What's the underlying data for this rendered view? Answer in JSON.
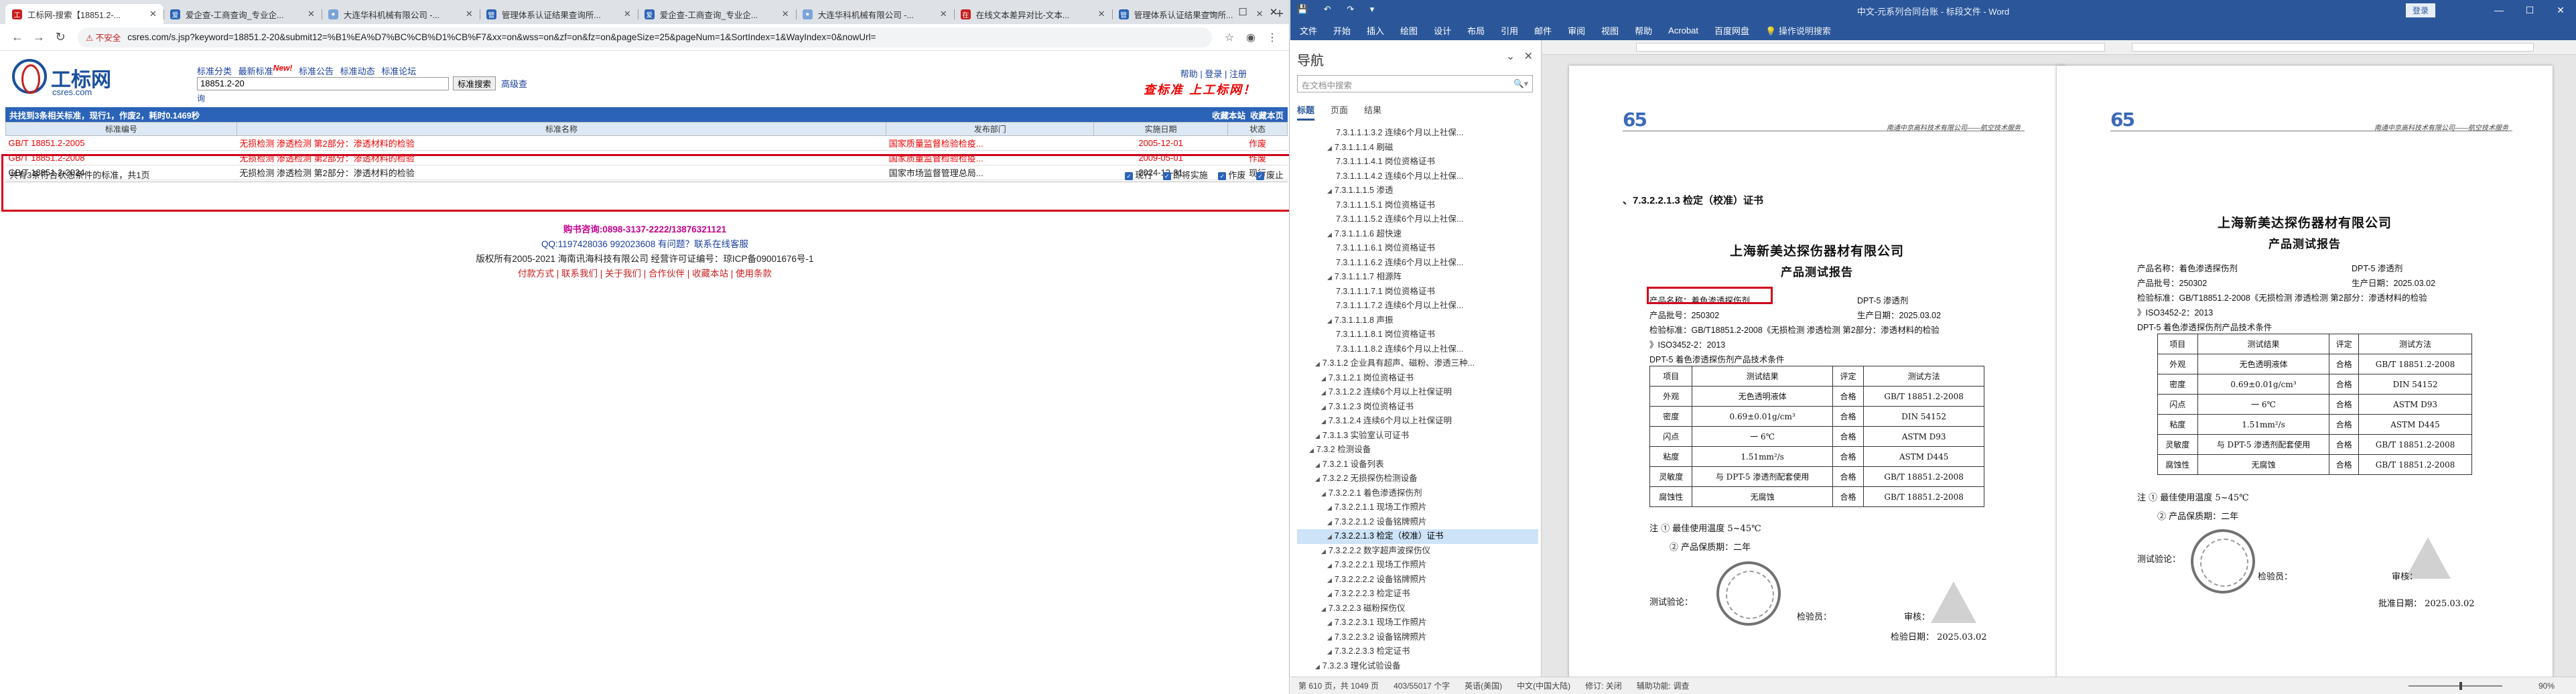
{
  "browser": {
    "tabs": [
      {
        "title": "工标网-搜索【18851.2-...",
        "active": true,
        "color": "#c81e1e"
      },
      {
        "title": "爱企查-工商查询_专业企...",
        "active": false,
        "color": "#2a63b8"
      },
      {
        "title": "大连华科机械有限公司 -...",
        "active": false,
        "color": "#2a63b8"
      },
      {
        "title": "管理体系认证结果查询所...",
        "active": false,
        "color": "#2a63b8"
      },
      {
        "title": "爱企查-工商查询_专业企...",
        "active": false,
        "color": "#2a63b8"
      },
      {
        "title": "大连华科机械有限公司 -...",
        "active": false,
        "color": "#2a63b8"
      },
      {
        "title": "在线文本差异对比-文本...",
        "active": false,
        "color": "#c81e1e"
      },
      {
        "title": "管理体系认证结果查询所...",
        "active": false,
        "color": "#2a63b8"
      }
    ],
    "new_tab": "+",
    "insecure_label": "不安全",
    "url": "csres.com/s.jsp?keyword=18851.2-20&submit12=%B1%EA%D7%BC%CB%D1%CB%F7&xx=on&wss=on&zf=on&fz=on&pageSize=25&pageNum=1&SortIndex=1&WayIndex=0&nowUrl="
  },
  "site": {
    "logo_cn": "工标网",
    "logo_en": "csres.com",
    "menu": [
      "标准分类",
      "最新标准",
      "New!",
      "标准公告",
      "标准动态",
      "标准论坛"
    ],
    "search_value": "18851.2-20",
    "search_button": "标准搜索",
    "advanced": "高级查",
    "tiny": "询",
    "login": "帮助 | 登录 | 注册",
    "slogan": "查标准 上工标网！",
    "result_bar_left": "共找到3条相关标准，现行1，作废2，耗时0.1469秒",
    "result_bar_right_1": "收藏本站",
    "result_bar_right_2": "收藏本页",
    "columns": [
      "标准编号",
      "标准名称",
      "发布部门",
      "实施日期",
      "状态"
    ],
    "rows": [
      {
        "std": "GB/T 18851.2-2005",
        "title": "无损检测 渗透检测 第2部分：渗透材料的检验",
        "dept": "国家质量监督检验检疫...",
        "date": "2005-12-01",
        "status": "作废",
        "obsolete": true
      },
      {
        "std": "GB/T 18851.2-2008",
        "title": "无损检测 渗透检测 第2部分：渗透材料的检验",
        "dept": "国家质量监督检验检疫...",
        "date": "2009-05-01",
        "status": "作废",
        "obsolete": true
      },
      {
        "std": "GB/T 18851.2-2024",
        "title": "无损检测 渗透检测 第2部分：渗透材料的检验",
        "dept": "国家市场监督管理总局...",
        "date": "2024-12-31",
        "status": "现行",
        "obsolete": false
      }
    ],
    "summary": "共有3条符合状态条件的标准，共1页",
    "filters": [
      "现行",
      "即将实施",
      "作废",
      "废止"
    ],
    "foot_phone": "购书咨询:0898-3137-2222/13876321121",
    "foot_qq": "QQ:1197428036 992023608 有问题？联系在线客服",
    "foot_copy": "版权所有2005-2021 海南讯海科技有限公司 经营许可证编号：琼ICP备09001676号-1",
    "foot_links": "付款方式 | 联系我们 | 关于我们 | 合作伙伴 | 收藏本站 | 使用条款"
  },
  "word": {
    "quick_access": "💾 ↶ ↷ ▾",
    "doc_title": "中文-元系列合同台账 - 标段文件 - Word",
    "user": "登录",
    "ribbon": [
      "文件",
      "开始",
      "插入",
      "绘图",
      "设计",
      "布局",
      "引用",
      "邮件",
      "审阅",
      "视图",
      "帮助",
      "Acrobat",
      "百度网盘",
      "操作说明搜索"
    ],
    "nav_title": "导航",
    "nav_search": "在文档中搜索",
    "nav_tabs": [
      "标题",
      "页面",
      "结果"
    ],
    "nav_items": [
      "7.3.1.1.1.3.2 连续6个月以上社保...",
      "7.3.1.1.1.4 刷磁",
      "7.3.1.1.1.4.1 岗位资格证书",
      "7.3.1.1.1.4.2 连续6个月以上社保...",
      "7.3.1.1.1.5 渗透",
      "7.3.1.1.1.5.1 岗位资格证书",
      "7.3.1.1.1.5.2 连续6个月以上社保...",
      "7.3.1.1.1.6 超快速",
      "7.3.1.1.1.6.1 岗位资格证书",
      "7.3.1.1.1.6.2 连续6个月以上社保...",
      "7.3.1.1.1.7 相源阵",
      "7.3.1.1.1.7.1 岗位资格证书",
      "7.3.1.1.1.7.2 连续6个月以上社保...",
      "7.3.1.1.1.8 声振",
      "7.3.1.1.1.8.1 岗位资格证书",
      "7.3.1.1.1.8.2 连续6个月以上社保...",
      "7.3.1.2 企业具有超声、磁粉、渗透三种...",
      "7.3.1.2.1 岗位资格证书",
      "7.3.1.2.2 连续6个月以上社保证明",
      "7.3.1.2.3 岗位资格证书",
      "7.3.1.2.4 连续6个月以上社保证明",
      "7.3.1.3 实验室认可证书",
      "7.3.2 检测设备",
      "7.3.2.1 设备列表",
      "7.3.2.2 无损探伤检测设备",
      "7.3.2.2.1 着色渗透探伤剂",
      "7.3.2.2.1.1 现场工作照片",
      "7.3.2.2.1.2 设备铭牌照片",
      "7.3.2.2.1.3 检定（校准）证书",
      "7.3.2.2.2 数字超声波探伤仪",
      "7.3.2.2.2.1 现场工作照片",
      "7.3.2.2.2.2 设备铭牌照片",
      "7.3.2.2.2.3 检定证书",
      "7.3.2.2.3 磁粉探伤仪",
      "7.3.2.2.3.1 现场工作照片",
      "7.3.2.2.3.2 设备铭牌照片",
      "7.3.2.2.3.3 检定证书",
      "7.3.2.3 理化试验设备"
    ],
    "nav_selected_index": 28,
    "page1": {
      "header_logo": "65",
      "header_company": "南通中京高科技术有限公司——航空技术服务",
      "section": "、7.3.2.2.1.3 检定（校准）证书",
      "company": "上海新美达探伤器材有限公司",
      "report": "产品测试报告",
      "name_label": "产品名称：着色渗透探伤剂",
      "model_label": "DPT-5 渗透剂",
      "batch_label": "产品批号：250302",
      "date_label": "生产日期：2025.03.02",
      "basis_prefix": "检验标准：GB/T18851.2-2008",
      "basis_rest": "《无损检测  渗透检测  第2部分：渗透材料的检验",
      "basis_2": "》ISO3452-2：2013",
      "table_caption": "DPT-5 着色渗透探伤剂产品技术条件",
      "table_head": [
        "项目",
        "测试结果",
        "评定",
        "测试方法"
      ],
      "table_rows": [
        [
          "外观",
          "无色透明液体",
          "合格",
          "GB/T 18851.2-2008"
        ],
        [
          "密度",
          "0.69±0.01g/cm³",
          "合格",
          "DIN 54152"
        ],
        [
          "闪点",
          "一 6℃",
          "合格",
          "ASTM D93"
        ],
        [
          "粘度",
          "1.51mm²/s",
          "合格",
          "ASTM D445"
        ],
        [
          "灵敏度",
          "与 DPT-5 渗透剂配套使用",
          "合格",
          "GB/T 18851.2-2008"
        ],
        [
          "腐蚀性",
          "无腐蚀",
          "合格",
          "GB/T 18851.2-2008"
        ]
      ],
      "note1": "注  ①  最佳使用温度 5~45℃",
      "note2": "②  产品保质期：二年",
      "tester": "测试验论：",
      "inspector": "检验员：",
      "approver": "审核：",
      "check_date": "检验日期：  2025.03.02"
    },
    "page2": {
      "section": "",
      "basis_prefix": "检验标准：GB/T18851.2-2008",
      "basis_rest": "《无损检测  渗透检测  第2部分：渗透材料的检验",
      "basis_2": "》ISO3452-2：2013",
      "approve_date": "批准日期：  2025.03.02",
      "tester2": "测试验论：",
      "inspector2": "检验员："
    },
    "status": [
      "第 610 页，共 1049 页",
      "403/55017 个字",
      "英语(美国)",
      "中文(中国大陆)",
      "修订: 关闭",
      "辅助功能: 调查"
    ],
    "zoom": "90%"
  }
}
